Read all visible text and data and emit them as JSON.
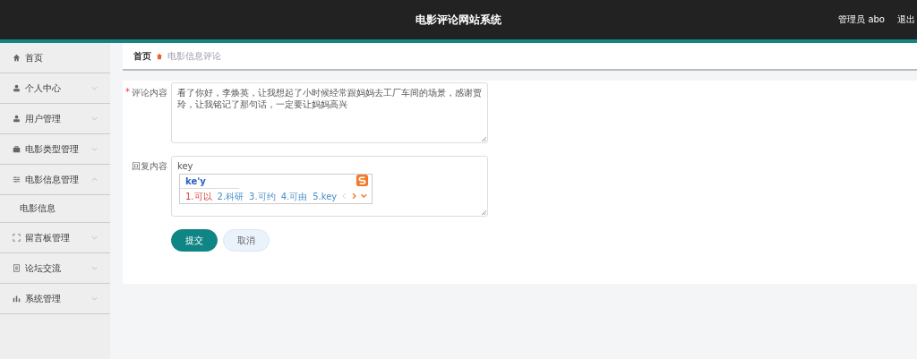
{
  "header": {
    "title": "电影评论网站系统",
    "user": "管理员 abo",
    "logout": "退出"
  },
  "sidebar": {
    "items": [
      {
        "label": "首页"
      },
      {
        "label": "个人中心",
        "expanded": false
      },
      {
        "label": "用户管理",
        "expanded": false
      },
      {
        "label": "电影类型管理",
        "expanded": false
      },
      {
        "label": "电影信息管理",
        "expanded": true,
        "children": [
          {
            "label": "电影信息"
          }
        ]
      },
      {
        "label": "留言板管理",
        "expanded": false
      },
      {
        "label": "论坛交流",
        "expanded": false
      },
      {
        "label": "系统管理",
        "expanded": false
      }
    ]
  },
  "breadcrumb": [
    "首页",
    "电影信息评论"
  ],
  "form": {
    "fields": [
      {
        "label": "评论内容",
        "required_mark": "*",
        "value": "看了你好，李焕英，让我想起了小时候经常跟妈妈去工厂车间的场景，感谢贾玲，让我铭记了那句话，一定要让妈妈高兴"
      },
      {
        "label": "回复内容",
        "value": "key"
      }
    ],
    "buttons": [
      {
        "label": "提交",
        "kind": "primary"
      },
      {
        "label": "取消",
        "kind": "secondary"
      }
    ]
  },
  "ime": {
    "composition": "ke'y",
    "candidates": [
      {
        "label": "1.可以",
        "selected": true
      },
      {
        "label": "2.科研",
        "selected": false
      },
      {
        "label": "3.可约",
        "selected": false
      },
      {
        "label": "4.可由",
        "selected": false
      },
      {
        "label": "5.key",
        "selected": false
      }
    ]
  }
}
